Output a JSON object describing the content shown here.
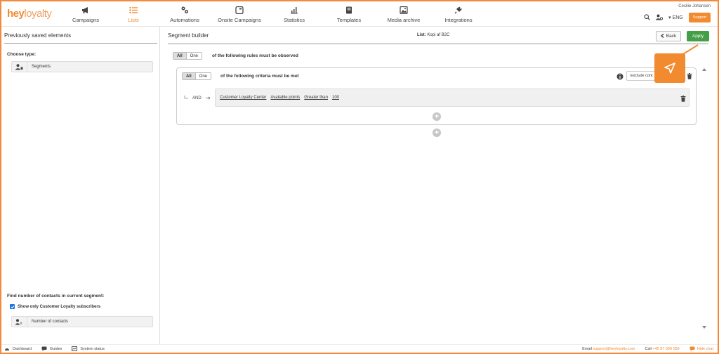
{
  "brand": {
    "logo_part1": "hey",
    "logo_part2": "loyalty",
    "accent_color": "#f28a30",
    "apply_color": "#43a047"
  },
  "nav": [
    {
      "label": "Campaigns",
      "icon": "megaphone-icon"
    },
    {
      "label": "Lists",
      "icon": "list-icon",
      "active": true
    },
    {
      "label": "Automations",
      "icon": "automation-icon"
    },
    {
      "label": "Onsite Campaigns",
      "icon": "window-icon"
    },
    {
      "label": "Statistics",
      "icon": "chart-icon"
    },
    {
      "label": "Templates",
      "icon": "template-icon"
    },
    {
      "label": "Media archive",
      "icon": "image-icon"
    },
    {
      "label": "Integrations",
      "icon": "plug-icon"
    }
  ],
  "header": {
    "username": "Cecilie Johansen",
    "language": "ENG",
    "support_label": "Support"
  },
  "left": {
    "title": "Previously saved elements",
    "choose_type": "Choose type:",
    "segments_label": "Segments",
    "find_title": "Find number of contacts in current segment:",
    "checkbox_label": "Show only Customer Loyalty subscribers",
    "number_label": "Number of contacts"
  },
  "main": {
    "title": "Segment builder",
    "list_prefix": "List:",
    "list_name": "Kopi af B2C",
    "back_label": "Back",
    "apply_label": "Apply",
    "outer_toggle": {
      "all": "All",
      "one": "One"
    },
    "outer_text": "of the following rules must be observed",
    "inner_toggle": {
      "all": "All",
      "one": "One"
    },
    "inner_text": "of the following criteria must be met",
    "exclude_label": "Exclude cont",
    "and_label": "AND",
    "criteria": [
      "Customer Loyalty Center",
      "Available points",
      "Greater than",
      "100"
    ]
  },
  "footer": {
    "dashboard": "Dashboard",
    "guides": "Guides",
    "system_status": "System status",
    "email_label": "Email",
    "email": "support@heyloyalty.com",
    "call_label": "Call",
    "phone": "+45 87 300 599",
    "hide_chat": "Hide chat"
  }
}
